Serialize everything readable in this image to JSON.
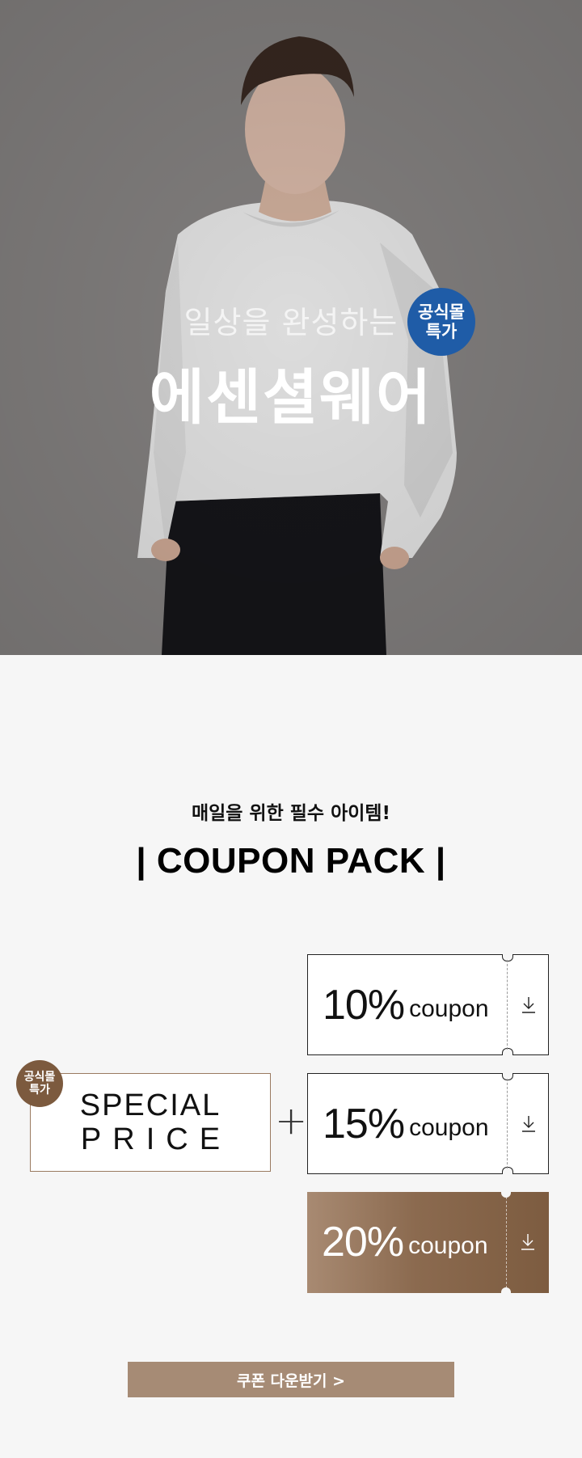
{
  "hero": {
    "subtitle": "일상을 완성하는",
    "title": "에센셜웨어",
    "badge_line1": "공식몰",
    "badge_line2": "특가"
  },
  "section": {
    "tagline": "매일을 위한 필수 아이템!",
    "heading": "| COUPON PACK |"
  },
  "special": {
    "badge_line1": "공식몰",
    "badge_line2": "특가",
    "line1": "SPECIAL",
    "line2": "PRICE",
    "plus": "+"
  },
  "coupons": [
    {
      "percent": "10%",
      "word": "coupon"
    },
    {
      "percent": "15%",
      "word": "coupon"
    },
    {
      "percent": "20%",
      "word": "coupon"
    }
  ],
  "cta": {
    "label": "쿠폰 다운받기 >"
  },
  "colors": {
    "badge_blue": "#1f5ca7",
    "brown_accent": "#7c5a3e",
    "button": "#a68b75",
    "background": "#f6f6f6"
  },
  "icons": {
    "download": "download-arrow-icon"
  }
}
